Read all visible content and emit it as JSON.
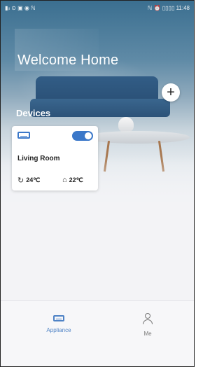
{
  "status_bar": {
    "left": "▮ᵢₗ ⊙ ▣ ◉ ℕ",
    "right": "ℕ ⏰ ▯▯▯▯ 11:48"
  },
  "header": {
    "title": "Welcome Home",
    "add_icon": "plus-icon",
    "add_label": "+"
  },
  "devices": {
    "section_label": "Devices",
    "items": [
      {
        "icon": "air-conditioner-icon",
        "name": "Living Room",
        "power_on": true,
        "set_temp": "24℃",
        "room_temp": "22℃",
        "set_temp_icon": "cooling-mode-icon",
        "room_temp_icon": "home-temperature-icon"
      }
    ]
  },
  "bottom_nav": {
    "items": [
      {
        "label": "Appliance",
        "icon": "appliance-icon",
        "active": true
      },
      {
        "label": "Me",
        "icon": "user-icon",
        "active": false
      }
    ]
  },
  "colors": {
    "accent": "#3b78c9",
    "active_nav": "#4f83c6",
    "inactive_nav": "#777777"
  }
}
